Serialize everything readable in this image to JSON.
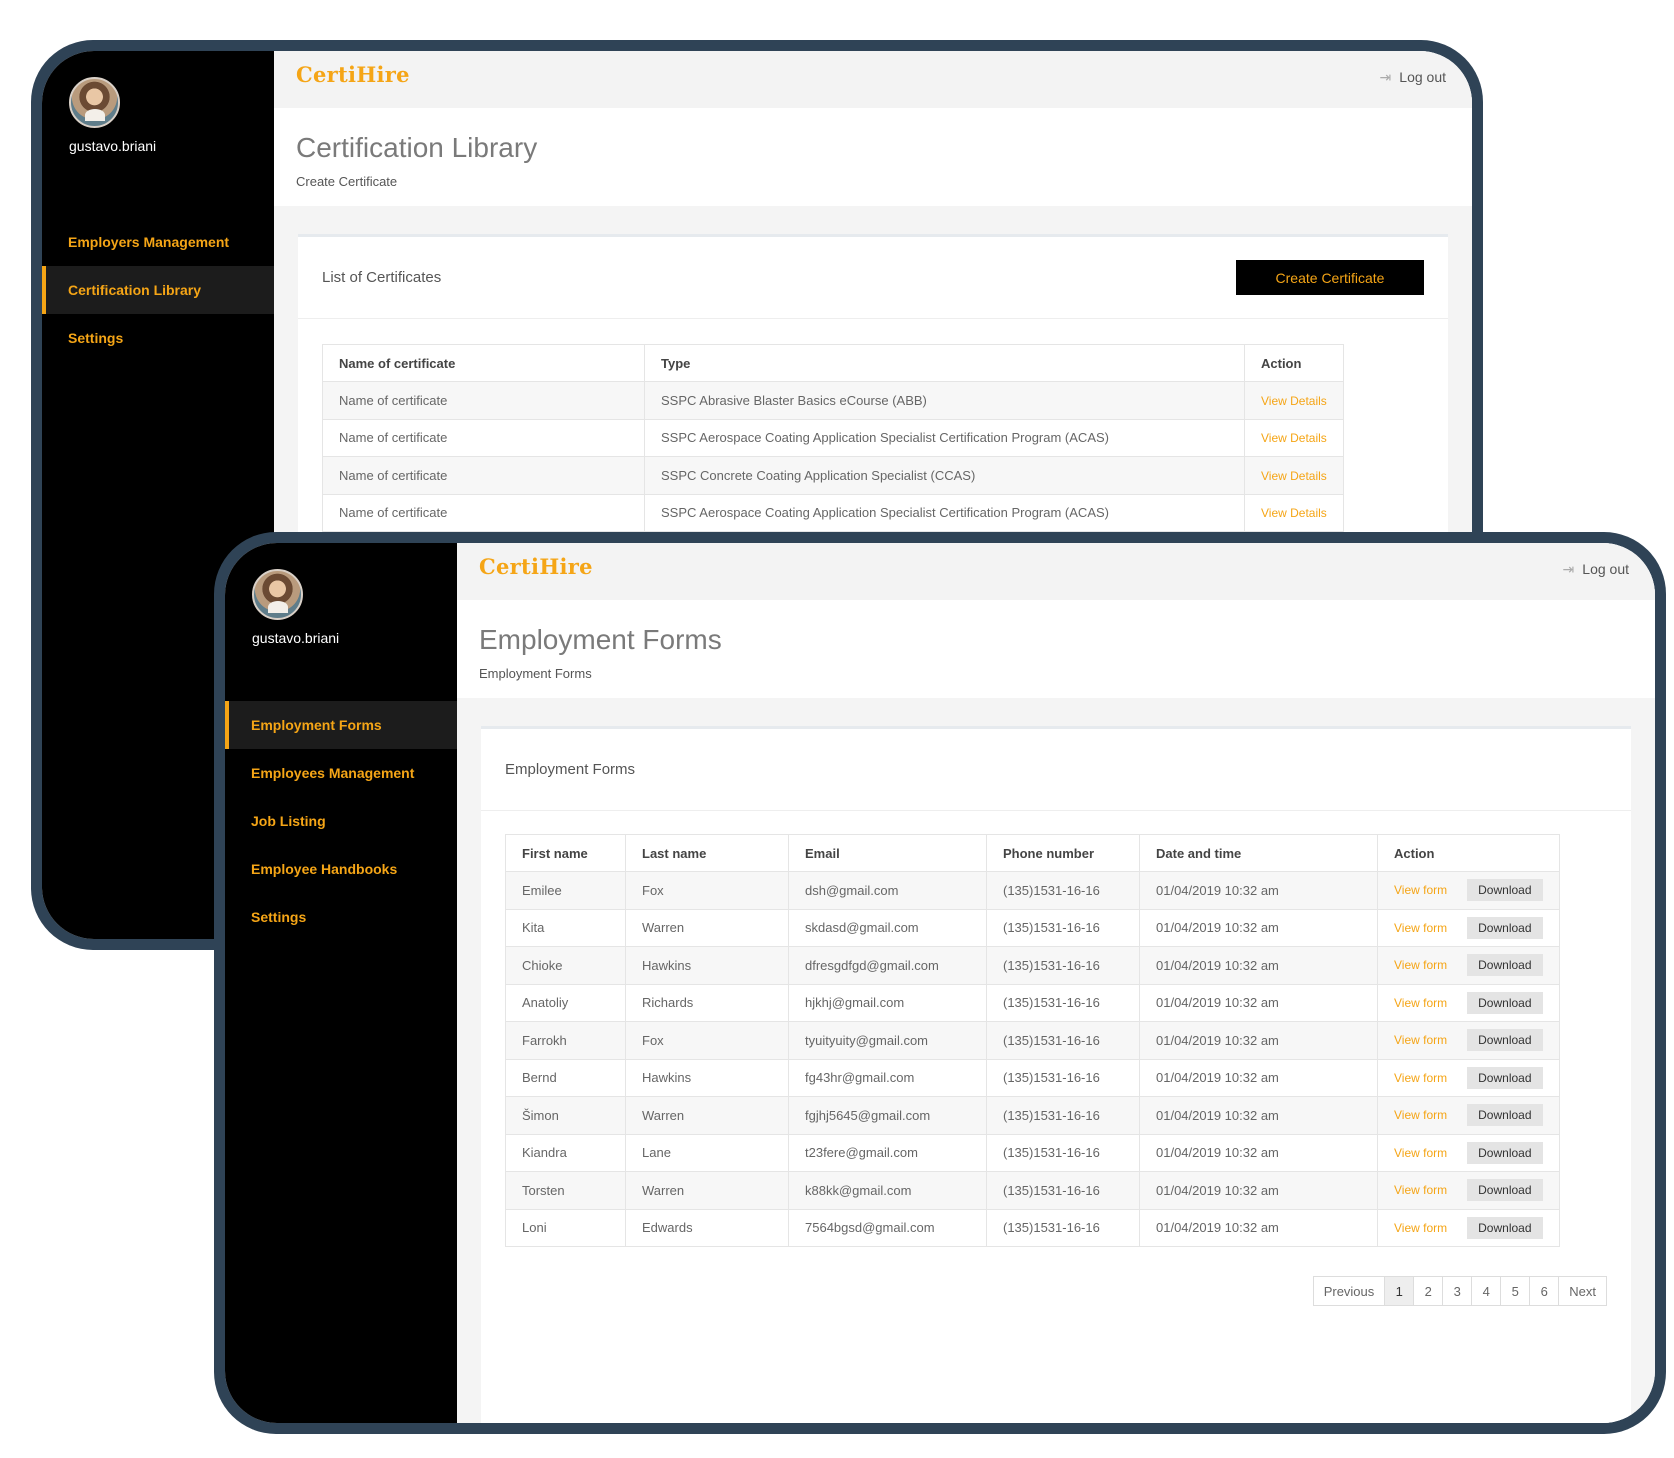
{
  "back": {
    "user": {
      "name": "gustavo.briani"
    },
    "nav": [
      {
        "label": "Employers Management",
        "active": false
      },
      {
        "label": "Certification Library",
        "active": true
      },
      {
        "label": "Settings",
        "active": false
      }
    ],
    "brand": "CertiHire",
    "logout": "Log out",
    "page_title": "Certification Library",
    "page_subtitle": "Create Certificate",
    "card_title": "List of Certificates",
    "create_button": "Create Certificate",
    "columns": [
      "Name of certificate",
      "Type",
      "Action"
    ],
    "rows": [
      {
        "name": "Name of certificate",
        "type": "SSPC Abrasive Blaster Basics eCourse (ABB)",
        "action": "View Details"
      },
      {
        "name": "Name of certificate",
        "type": "SSPC Aerospace Coating Application Specialist Certification Program (ACAS)",
        "action": "View Details"
      },
      {
        "name": "Name of certificate",
        "type": "SSPC Concrete Coating Application Specialist (CCAS)",
        "action": "View Details"
      },
      {
        "name": "Name of certificate",
        "type": "SSPC Aerospace Coating Application Specialist Certification Program (ACAS)",
        "action": "View Details"
      }
    ]
  },
  "front": {
    "user": {
      "name": "gustavo.briani"
    },
    "nav": [
      {
        "label": "Employment Forms",
        "active": true
      },
      {
        "label": "Employees Management",
        "active": false
      },
      {
        "label": "Job Listing",
        "active": false
      },
      {
        "label": "Employee Handbooks",
        "active": false
      },
      {
        "label": "Settings",
        "active": false
      }
    ],
    "brand": "CertiHire",
    "logout": "Log out",
    "page_title": "Employment Forms",
    "page_subtitle": "Employment Forms",
    "card_title": "Employment Forms",
    "columns": [
      "First name",
      "Last name",
      "Email",
      "Phone number",
      "Date and time",
      "Action"
    ],
    "view_label": "View form",
    "download_label": "Download",
    "rows": [
      {
        "first": "Emilee",
        "last": "Fox",
        "email": "dsh@gmail.com",
        "phone": "(135)1531-16-16",
        "datetime": "01/04/2019 10:32 am"
      },
      {
        "first": "Kita",
        "last": "Warren",
        "email": "skdasd@gmail.com",
        "phone": "(135)1531-16-16",
        "datetime": "01/04/2019 10:32 am"
      },
      {
        "first": "Chioke",
        "last": "Hawkins",
        "email": "dfresgdfgd@gmail.com",
        "phone": "(135)1531-16-16",
        "datetime": "01/04/2019 10:32 am"
      },
      {
        "first": "Anatoliy",
        "last": "Richards",
        "email": "hjkhj@gmail.com",
        "phone": "(135)1531-16-16",
        "datetime": "01/04/2019 10:32 am"
      },
      {
        "first": "Farrokh",
        "last": "Fox",
        "email": "tyuityuity@gmail.com",
        "phone": "(135)1531-16-16",
        "datetime": "01/04/2019 10:32 am"
      },
      {
        "first": "Bernd",
        "last": "Hawkins",
        "email": "fg43hr@gmail.com",
        "phone": "(135)1531-16-16",
        "datetime": "01/04/2019 10:32 am"
      },
      {
        "first": "Šimon",
        "last": "Warren",
        "email": "fgjhj5645@gmail.com",
        "phone": "(135)1531-16-16",
        "datetime": "01/04/2019 10:32 am"
      },
      {
        "first": "Kiandra",
        "last": "Lane",
        "email": "t23fere@gmail.com",
        "phone": "(135)1531-16-16",
        "datetime": "01/04/2019 10:32 am"
      },
      {
        "first": "Torsten",
        "last": "Warren",
        "email": "k88kk@gmail.com",
        "phone": "(135)1531-16-16",
        "datetime": "01/04/2019 10:32 am"
      },
      {
        "first": "Loni",
        "last": "Edwards",
        "email": "7564bgsd@gmail.com",
        "phone": "(135)1531-16-16",
        "datetime": "01/04/2019 10:32 am"
      }
    ],
    "pagination": {
      "previous": "Previous",
      "pages": [
        "1",
        "2",
        "3",
        "4",
        "5",
        "6"
      ],
      "current": "1",
      "next": "Next"
    }
  },
  "icons": {
    "logout": "logout-icon",
    "avatar": "avatar"
  },
  "colors": {
    "accent": "#f5a516",
    "frame": "#2f4356",
    "sidebar": "#000000"
  }
}
